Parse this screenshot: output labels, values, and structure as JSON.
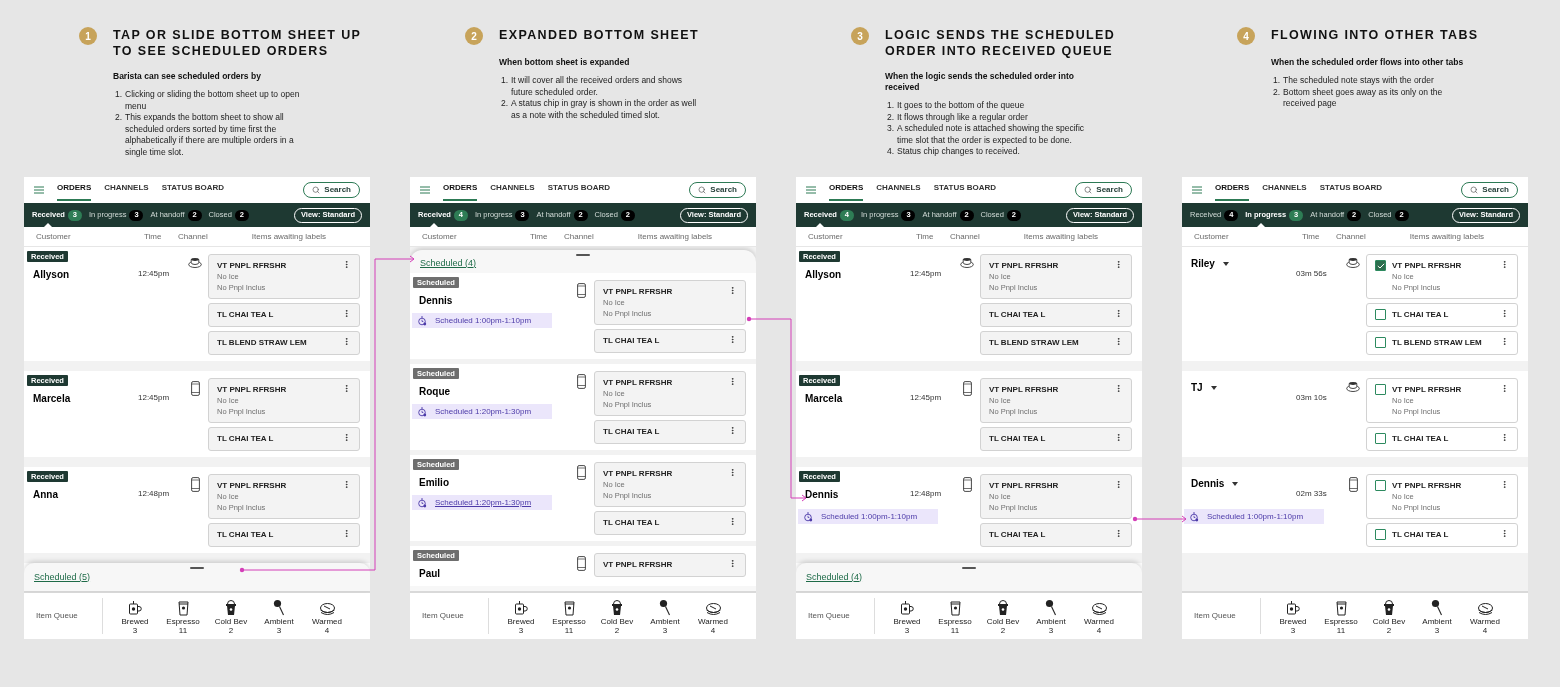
{
  "panels": [
    {
      "step": "1",
      "title": "TAP OR SLIDE BOTTOM SHEET UP TO SEE SCHEDULED ORDERS",
      "lead": "Barista can see scheduled orders by",
      "points": [
        {
          "number": "1.",
          "text": "Clicking or sliding the bottom sheet up to open menu"
        },
        {
          "number": "2.",
          "text": "This expands the bottom sheet to show all scheduled orders sorted by time first the alphabetically if there are multiple orders in a single time slot."
        }
      ],
      "screen": {
        "nav": [
          {
            "label": "ORDERS",
            "selected": true
          },
          {
            "label": "CHANNELS",
            "selected": false
          },
          {
            "label": "STATUS BOARD",
            "selected": false
          }
        ],
        "search": "Search",
        "tabs": [
          {
            "label": "Received",
            "count": "3",
            "selected": true
          },
          {
            "label": "In progress",
            "count": "3",
            "selected": false
          },
          {
            "label": "At handoff",
            "count": "2",
            "selected": false
          },
          {
            "label": "Closed",
            "count": "2",
            "selected": false
          }
        ],
        "view_button": "View: Standard",
        "columns": [
          "Customer",
          "Time",
          "Channel",
          "Items awaiting labels"
        ],
        "orders": [
          {
            "status": {
              "label": "Received",
              "kind": "received"
            },
            "name": "Allyson",
            "time": "12:45pm",
            "channel": {
              "kind": "cup"
            },
            "items": [
              {
                "name": "VT PNPL RFRSHR",
                "modifiers": [
                  "No Ice",
                  "No Pnpl Inclus"
                ]
              },
              {
                "name": "TL CHAI TEA L"
              },
              {
                "name": "TL BLEND STRAW LEM"
              }
            ]
          },
          {
            "status": {
              "label": "Received",
              "kind": "received"
            },
            "name": "Marcela",
            "time": "12:45pm",
            "channel": {
              "kind": "phone"
            },
            "items": [
              {
                "name": "VT PNPL RFRSHR",
                "modifiers": [
                  "No Ice",
                  "No Pnpl Inclus"
                ]
              },
              {
                "name": "TL CHAI TEA L"
              }
            ]
          },
          {
            "status": {
              "label": "Received",
              "kind": "received"
            },
            "name": "Anna",
            "time": "12:48pm",
            "channel": {
              "kind": "phone"
            },
            "items": [
              {
                "name": "VT PNPL RFRSHR",
                "modifiers": [
                  "No Ice",
                  "No Pnpl Inclus"
                ]
              },
              {
                "name": "TL CHAI TEA L"
              }
            ]
          }
        ],
        "sheet": {
          "label": "Scheduled (5)",
          "expanded": false
        },
        "queue": {
          "label": "Item Queue",
          "stations": [
            {
              "kind": "brewed",
              "label": "Brewed",
              "count": "3"
            },
            {
              "kind": "espresso",
              "label": "Espresso",
              "count": "11"
            },
            {
              "kind": "cold",
              "label": "Cold Bev",
              "count": "2"
            },
            {
              "kind": "ambient",
              "label": "Ambient",
              "count": "3"
            },
            {
              "kind": "warmed",
              "label": "Warmed",
              "count": "4"
            }
          ]
        }
      }
    },
    {
      "step": "2",
      "title": "EXPANDED BOTTOM SHEET",
      "lead": "When bottom sheet is expanded",
      "points": [
        {
          "number": "1.",
          "text": "It will cover all the received orders and shows future scheduled order."
        },
        {
          "number": "2.",
          "text": "A status chip in gray is shown in the order as well as a note with the scheduled timed slot."
        }
      ],
      "screen": {
        "nav": [
          {
            "label": "ORDERS",
            "selected": true
          },
          {
            "label": "CHANNELS",
            "selected": false
          },
          {
            "label": "STATUS BOARD",
            "selected": false
          }
        ],
        "search": "Search",
        "tabs": [
          {
            "label": "Received",
            "count": "4",
            "selected": true
          },
          {
            "label": "In progress",
            "count": "3",
            "selected": false
          },
          {
            "label": "At handoff",
            "count": "2",
            "selected": false
          },
          {
            "label": "Closed",
            "count": "2",
            "selected": false
          }
        ],
        "view_button": "View: Standard",
        "columns": [
          "Customer",
          "Time",
          "Channel",
          "Items awaiting labels"
        ],
        "sheet": {
          "label": "Scheduled (4)",
          "expanded": true,
          "orders": [
            {
              "status": {
                "label": "Scheduled",
                "kind": "scheduled"
              },
              "name": "Dennis",
              "channel": {
                "kind": "phone"
              },
              "note": {
                "text": "Scheduled 1:00pm-1:10pm",
                "underlined": false
              },
              "items": [
                {
                  "name": "VT PNPL RFRSHR",
                  "modifiers": [
                    "No Ice",
                    "No Pnpl Inclus"
                  ]
                },
                {
                  "name": "TL CHAI TEA L"
                }
              ]
            },
            {
              "status": {
                "label": "Scheduled",
                "kind": "scheduled"
              },
              "name": "Roque",
              "channel": {
                "kind": "phone"
              },
              "note": {
                "text": "Scheduled 1:20pm-1:30pm",
                "underlined": false
              },
              "items": [
                {
                  "name": "VT PNPL RFRSHR",
                  "modifiers": [
                    "No Ice",
                    "No Pnpl Inclus"
                  ]
                },
                {
                  "name": "TL CHAI TEA L"
                }
              ]
            },
            {
              "status": {
                "label": "Scheduled",
                "kind": "scheduled"
              },
              "name": "Emilio",
              "channel": {
                "kind": "phone"
              },
              "note": {
                "text": "Scheduled 1:20pm-1:30pm",
                "underlined": true
              },
              "items": [
                {
                  "name": "VT PNPL RFRSHR",
                  "modifiers": [
                    "No Ice",
                    "No Pnpl Inclus"
                  ]
                },
                {
                  "name": "TL CHAI TEA L"
                }
              ]
            },
            {
              "status": {
                "label": "Scheduled",
                "kind": "scheduled"
              },
              "name": "Paul",
              "channel": {
                "kind": "phone"
              },
              "items": [
                {
                  "name": "VT PNPL RFRSHR"
                }
              ]
            }
          ]
        },
        "queue": {
          "label": "Item Queue",
          "stations": [
            {
              "kind": "brewed",
              "label": "Brewed",
              "count": "3"
            },
            {
              "kind": "espresso",
              "label": "Espresso",
              "count": "11"
            },
            {
              "kind": "cold",
              "label": "Cold Bev",
              "count": "2"
            },
            {
              "kind": "ambient",
              "label": "Ambient",
              "count": "3"
            },
            {
              "kind": "warmed",
              "label": "Warmed",
              "count": "4"
            }
          ]
        }
      }
    },
    {
      "step": "3",
      "title": "LOGIC SENDS THE SCHEDULED ORDER INTO RECEIVED QUEUE",
      "lead": "When the logic sends the scheduled order into received",
      "points": [
        {
          "number": "1.",
          "text": "It goes to the bottom of the queue"
        },
        {
          "number": "2.",
          "text": "It flows through like a regular order"
        },
        {
          "number": "3.",
          "text": "A scheduled note is attached showing the specific time slot that the order is expected to be done."
        },
        {
          "number": "4.",
          "text": "Status chip changes to received."
        }
      ],
      "screen": {
        "nav": [
          {
            "label": "ORDERS",
            "selected": true
          },
          {
            "label": "CHANNELS",
            "selected": false
          },
          {
            "label": "STATUS BOARD",
            "selected": false
          }
        ],
        "search": "Search",
        "tabs": [
          {
            "label": "Received",
            "count": "4",
            "selected": true
          },
          {
            "label": "In progress",
            "count": "3",
            "selected": false
          },
          {
            "label": "At handoff",
            "count": "2",
            "selected": false
          },
          {
            "label": "Closed",
            "count": "2",
            "selected": false
          }
        ],
        "view_button": "View: Standard",
        "columns": [
          "Customer",
          "Time",
          "Channel",
          "Items awaiting labels"
        ],
        "orders": [
          {
            "status": {
              "label": "Received",
              "kind": "received"
            },
            "name": "Allyson",
            "time": "12:45pm",
            "channel": {
              "kind": "cup"
            },
            "items": [
              {
                "name": "VT PNPL RFRSHR",
                "modifiers": [
                  "No Ice",
                  "No Pnpl Inclus"
                ]
              },
              {
                "name": "TL CHAI TEA L"
              },
              {
                "name": "TL BLEND STRAW LEM"
              }
            ]
          },
          {
            "status": {
              "label": "Received",
              "kind": "received"
            },
            "name": "Marcela",
            "time": "12:45pm",
            "channel": {
              "kind": "phone"
            },
            "items": [
              {
                "name": "VT PNPL RFRSHR",
                "modifiers": [
                  "No Ice",
                  "No Pnpl Inclus"
                ]
              },
              {
                "name": "TL CHAI TEA L"
              }
            ]
          },
          {
            "status": {
              "label": "Received",
              "kind": "received"
            },
            "name": "Dennis",
            "time": "12:48pm",
            "channel": {
              "kind": "phone"
            },
            "note": {
              "text": "Scheduled 1:00pm-1:10pm",
              "underlined": false
            },
            "items": [
              {
                "name": "VT PNPL RFRSHR",
                "modifiers": [
                  "No Ice",
                  "No Pnpl Inclus"
                ]
              },
              {
                "name": "TL CHAI TEA L"
              }
            ]
          }
        ],
        "sheet": {
          "label": "Scheduled (4)",
          "expanded": false
        },
        "queue": {
          "label": "Item Queue",
          "stations": [
            {
              "kind": "brewed",
              "label": "Brewed",
              "count": "3"
            },
            {
              "kind": "espresso",
              "label": "Espresso",
              "count": "11"
            },
            {
              "kind": "cold",
              "label": "Cold Bev",
              "count": "2"
            },
            {
              "kind": "ambient",
              "label": "Ambient",
              "count": "3"
            },
            {
              "kind": "warmed",
              "label": "Warmed",
              "count": "4"
            }
          ]
        }
      }
    },
    {
      "step": "4",
      "title": "FLOWING INTO OTHER TABS",
      "lead": "When the scheduled order flows into other tabs",
      "points": [
        {
          "number": "1.",
          "text": "The scheduled note stays with the order"
        },
        {
          "number": "2.",
          "text": "Bottom sheet goes away as its only on the received page"
        }
      ],
      "screen": {
        "nav": [
          {
            "label": "ORDERS",
            "selected": true
          },
          {
            "label": "CHANNELS",
            "selected": false
          },
          {
            "label": "STATUS BOARD",
            "selected": false
          }
        ],
        "search": "Search",
        "tabs": [
          {
            "label": "Received",
            "count": "4",
            "selected": false
          },
          {
            "label": "In progress",
            "count": "3",
            "selected": true
          },
          {
            "label": "At handoff",
            "count": "2",
            "selected": false
          },
          {
            "label": "Closed",
            "count": "2",
            "selected": false
          }
        ],
        "view_button": "View: Standard",
        "columns": [
          "Customer",
          "Time",
          "Channel",
          "Items awaiting labels"
        ],
        "orders": [
          {
            "name": "Riley",
            "dropdown": true,
            "time": "03m 56s",
            "channel": {
              "kind": "cup"
            },
            "items": [
              {
                "name": "VT PNPL RFRSHR",
                "modifiers": [
                  "No Ice",
                  "No Pnpl Inclus"
                ],
                "checked": true
              },
              {
                "name": "TL CHAI TEA L",
                "checked": false
              },
              {
                "name": "TL BLEND STRAW LEM",
                "checked": false
              }
            ]
          },
          {
            "name": "TJ",
            "dropdown": true,
            "time": "03m 10s",
            "channel": {
              "kind": "cup"
            },
            "items": [
              {
                "name": "VT PNPL RFRSHR",
                "modifiers": [
                  "No Ice",
                  "No Pnpl Inclus"
                ],
                "checked": false
              },
              {
                "name": "TL CHAI TEA L",
                "checked": false
              }
            ]
          },
          {
            "name": "Dennis",
            "dropdown": true,
            "time": "02m 33s",
            "channel": {
              "kind": "phone"
            },
            "note": {
              "text": "Scheduled 1:00pm-1:10pm",
              "underlined": false
            },
            "items": [
              {
                "name": "VT PNPL RFRSHR",
                "modifiers": [
                  "No Ice",
                  "No Pnpl Inclus"
                ],
                "checked": false
              },
              {
                "name": "TL CHAI TEA L",
                "checked": false
              }
            ]
          }
        ],
        "queue": {
          "label": "Item Queue",
          "stations": [
            {
              "kind": "brewed",
              "label": "Brewed",
              "count": "3"
            },
            {
              "kind": "espresso",
              "label": "Espresso",
              "count": "11"
            },
            {
              "kind": "cold",
              "label": "Cold Bev",
              "count": "2"
            },
            {
              "kind": "ambient",
              "label": "Ambient",
              "count": "3"
            },
            {
              "kind": "warmed",
              "label": "Warmed",
              "count": "4"
            }
          ]
        }
      }
    }
  ]
}
